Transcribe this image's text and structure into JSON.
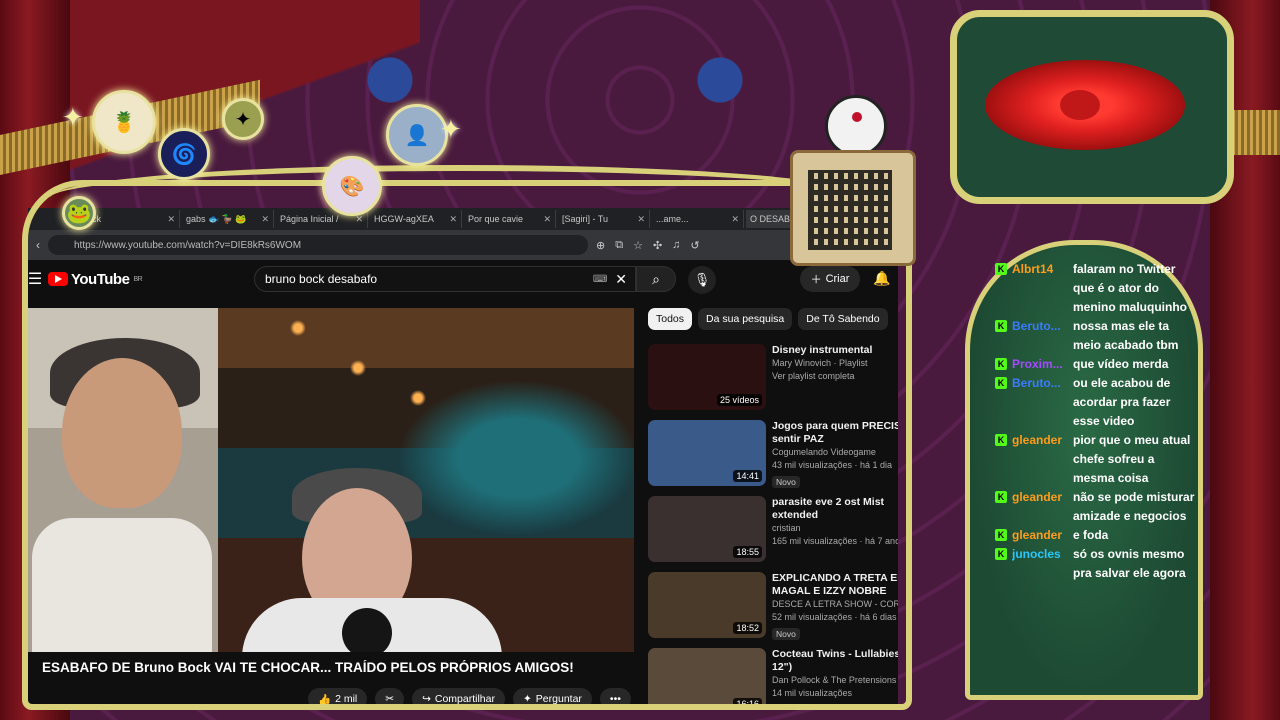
{
  "browser": {
    "tabs": [
      {
        "label": "ck"
      },
      {
        "label": "gabs 🐟 🦆 🐸"
      },
      {
        "label": "Página Inicial /"
      },
      {
        "label": "HGGW-agXEA"
      },
      {
        "label": "Por que cavie"
      },
      {
        "label": "[Sagiri] - Tu"
      },
      {
        "label": "...ame..."
      },
      {
        "label": "O DESAB"
      }
    ],
    "url": "https://www.youtube.com/watch?v=DIE8kRs6WOM"
  },
  "youtube": {
    "logo": "YouTube",
    "region": "BR",
    "search_value": "bruno bock desabafo",
    "create_label": "Criar",
    "video_title": "ESABAFO DE Bruno Bock VAI TE CHOCAR... TRAÍDO PELOS PRÓPRIOS AMIGOS!",
    "share_label": "Compartilhar",
    "ask_label": "Perguntar",
    "likes_label": "2 mil",
    "chips": [
      "Todos",
      "Da sua pesquisa",
      "De Tô Sabendo"
    ],
    "recommendations": [
      {
        "title": "Disney instrumental",
        "title2": "",
        "channel": "Mary Winovich · Playlist",
        "info": "Ver playlist completa",
        "duration": "25 vídeos",
        "badge": "",
        "thumb_color": "#2a1010"
      },
      {
        "title": "Jogos para quem PRECISA",
        "title2": "sentir PAZ",
        "channel": "Cogumelando Videogame",
        "info": "43 mil visualizações · há 1 dia",
        "duration": "14:41",
        "badge": "Novo",
        "thumb_color": "#3a5a8a"
      },
      {
        "title": "parasite eve 2 ost Mist",
        "title2": "extended",
        "channel": "cristian",
        "info": "165 mil visualizações · há 7 anos",
        "duration": "18:55",
        "badge": "",
        "thumb_color": "#3a3030"
      },
      {
        "title": "EXPLICANDO A TRETA ENTRE",
        "title2": "MAGAL E IZZY NOBRE",
        "channel": "DESCE A LETRA SHOW - CORTES",
        "info": "52 mil visualizações · há 6 dias",
        "duration": "18:52",
        "badge": "Novo",
        "thumb_color": "#4a3a2a"
      },
      {
        "title": "Cocteau Twins - Lullabies (F",
        "title2": "12\")",
        "channel": "Dan Pollock & The Pretensions M",
        "info": "14 mil visualizações",
        "duration": "16:16",
        "badge": "",
        "thumb_color": "#5a4a3a"
      }
    ]
  },
  "chat": [
    {
      "user": "Albrt14",
      "color": "#ff9d1a",
      "text": "falaram no Twitter que é o ator do menino maluquinho"
    },
    {
      "user": "Beruto...",
      "color": "#3a7bff",
      "text": "nossa mas ele ta meio acabado tbm"
    },
    {
      "user": "Proxim...",
      "color": "#a64bff",
      "text": "que vídeo merda"
    },
    {
      "user": "Beruto...",
      "color": "#3a7bff",
      "text": "ou ele acabou de acordar pra fazer esse video"
    },
    {
      "user": "gleander",
      "color": "#ff9d1a",
      "text": "pior que o meu atual chefe sofreu a mesma coisa"
    },
    {
      "user": "gleander",
      "color": "#ff9d1a",
      "text": "não se pode misturar amizade e negocios"
    },
    {
      "user": "gleander",
      "color": "#ff9d1a",
      "text": "e foda"
    },
    {
      "user": "junocles",
      "color": "#28c8ff",
      "text": "só os ovnis mesmo pra salvar ele agora"
    }
  ],
  "icons": {
    "kick_badge": "K",
    "frame_gold": "#d8d17a",
    "youtube_red": "#ff0000"
  }
}
